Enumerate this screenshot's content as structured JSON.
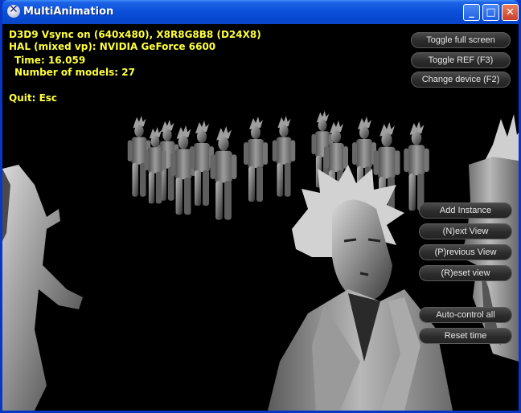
{
  "window": {
    "title": "MultiAnimation",
    "icon": "directx-icon",
    "controls": [
      "minimize-icon",
      "maximize-icon",
      "close-icon"
    ]
  },
  "hud": {
    "device_line": "D3D9 Vsync on (640x480), X8R8G8B8 (D24X8)",
    "adapter_line": "HAL (mixed vp): NVIDIA GeForce 6600",
    "time_line": "Time: 16.059",
    "models_line": "Number of models: 27",
    "quit_line": "Quit: Esc",
    "text_color": "#ffff3c"
  },
  "top_buttons": [
    {
      "label": "Toggle full screen"
    },
    {
      "label": "Toggle REF (F3)"
    },
    {
      "label": "Change device (F2)"
    }
  ],
  "right_buttons": [
    {
      "label": "Add Instance"
    },
    {
      "label": "(N)ext View"
    },
    {
      "label": "(P)revious View"
    },
    {
      "label": "(R)eset view"
    }
  ],
  "bottom_buttons": [
    {
      "label": "Auto-control all"
    },
    {
      "label": "Reset time"
    }
  ]
}
